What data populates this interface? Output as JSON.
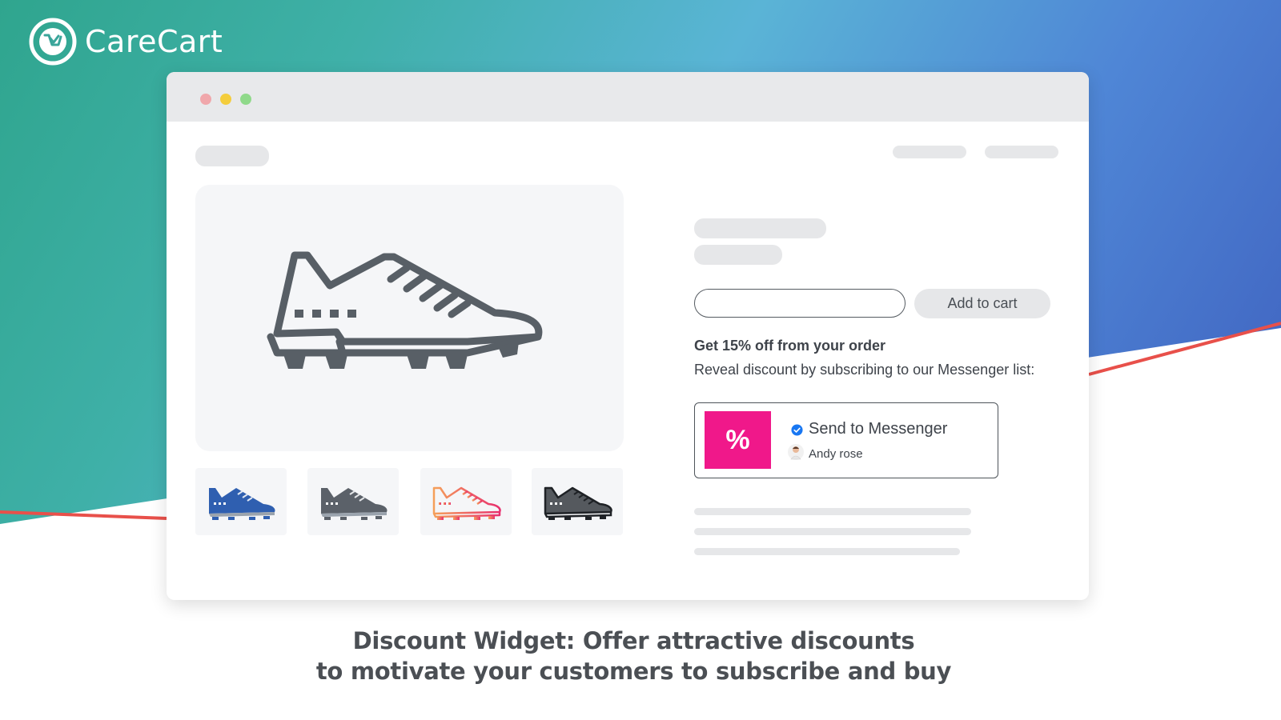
{
  "brand": {
    "name": "CareCart"
  },
  "browser": {
    "window_dots": [
      "red",
      "yellow",
      "green"
    ]
  },
  "product": {
    "add_to_cart_label": "Add to cart",
    "quantity_value": "",
    "thumbnail_colors": [
      "#2f5fb0",
      "#5b6169",
      "#f07a5a",
      "#2a2d31"
    ],
    "main_shoe_icon": "cleat-shoe-icon"
  },
  "offer": {
    "title": "Get 15% off from your order",
    "subtitle": "Reveal discount by subscribing to our Messenger list:"
  },
  "messenger_widget": {
    "badge_symbol": "%",
    "badge_color": "#f0188a",
    "send_label": "Send to Messenger",
    "user_name": "Andy rose"
  },
  "caption": {
    "line1": "Discount Widget: Offer attractive discounts",
    "line2": "to motivate your customers to subscribe and buy"
  }
}
